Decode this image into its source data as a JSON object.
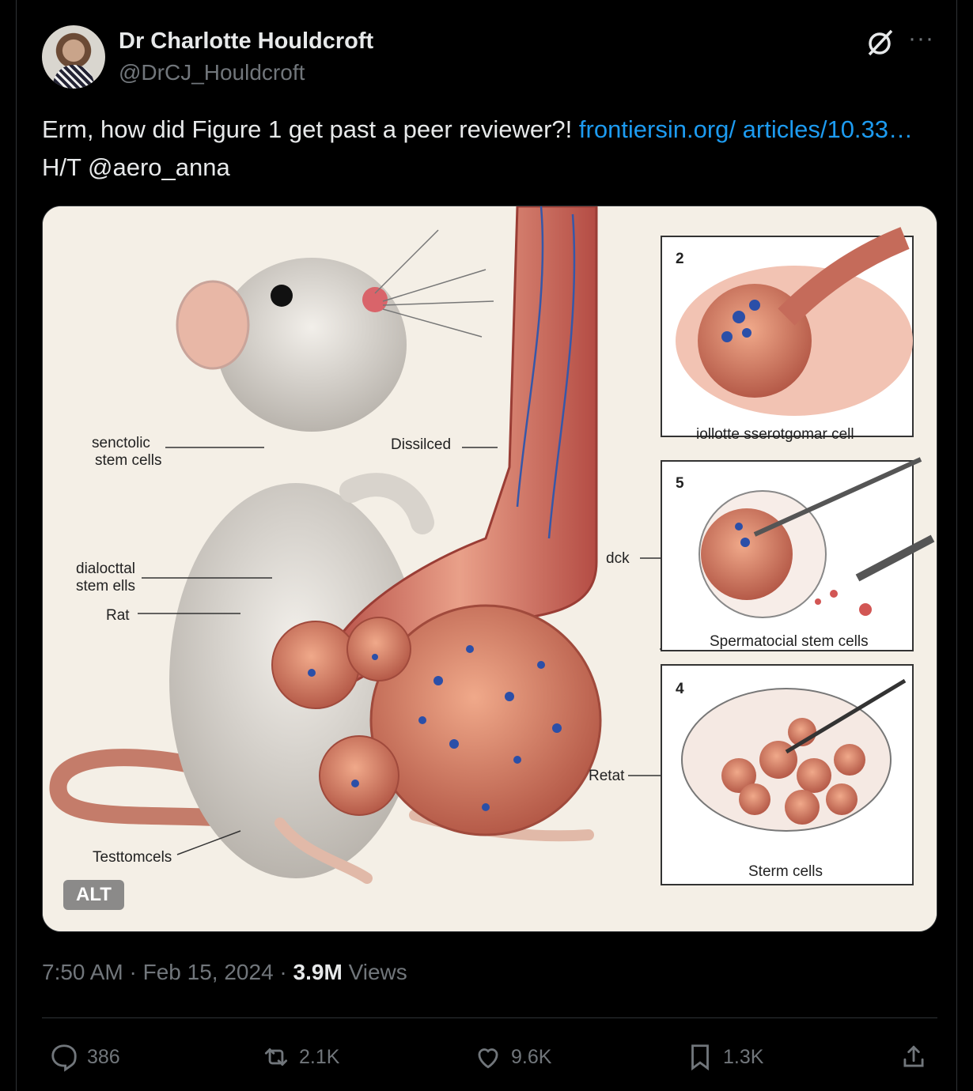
{
  "author": {
    "name": "Dr Charlotte Houldcroft",
    "handle": "@DrCJ_Houldcroft"
  },
  "tweet": {
    "text_before": "Erm, how did Figure 1 get past a peer reviewer?! ",
    "link": "frontiersin.org/ articles/10.33…",
    "text_after": " H/T @aero_anna"
  },
  "media": {
    "alt_badge": "ALT",
    "labels": {
      "senctolic": "senctolic",
      "stem_cells": "stem cells",
      "dissiced": "Dissilced",
      "dislocttal": "dialocttal",
      "stem_ells": "stem ells",
      "rat": "Rat",
      "testtomcels": "Testtomcels",
      "panel2_num": "2",
      "panel2_caption": "iollotte sserotgomar cell",
      "panel5_num": "5",
      "dck": "dck",
      "panel5_caption": "Spermatocial stem cells",
      "panel4_num": "4",
      "retat": "Retat",
      "panel4_caption": "Sterm cells"
    }
  },
  "meta": {
    "time": "7:50 AM",
    "sep1": " · ",
    "date": "Feb 15, 2024",
    "sep2": " · ",
    "views_count": "3.9M",
    "views_label": " Views"
  },
  "actions": {
    "replies": "386",
    "reposts": "2.1K",
    "likes": "9.6K",
    "bookmarks": "1.3K"
  },
  "icons": [
    "grok-icon",
    "more-icon",
    "reply-icon",
    "repost-icon",
    "like-icon",
    "bookmark-icon",
    "share-icon"
  ]
}
